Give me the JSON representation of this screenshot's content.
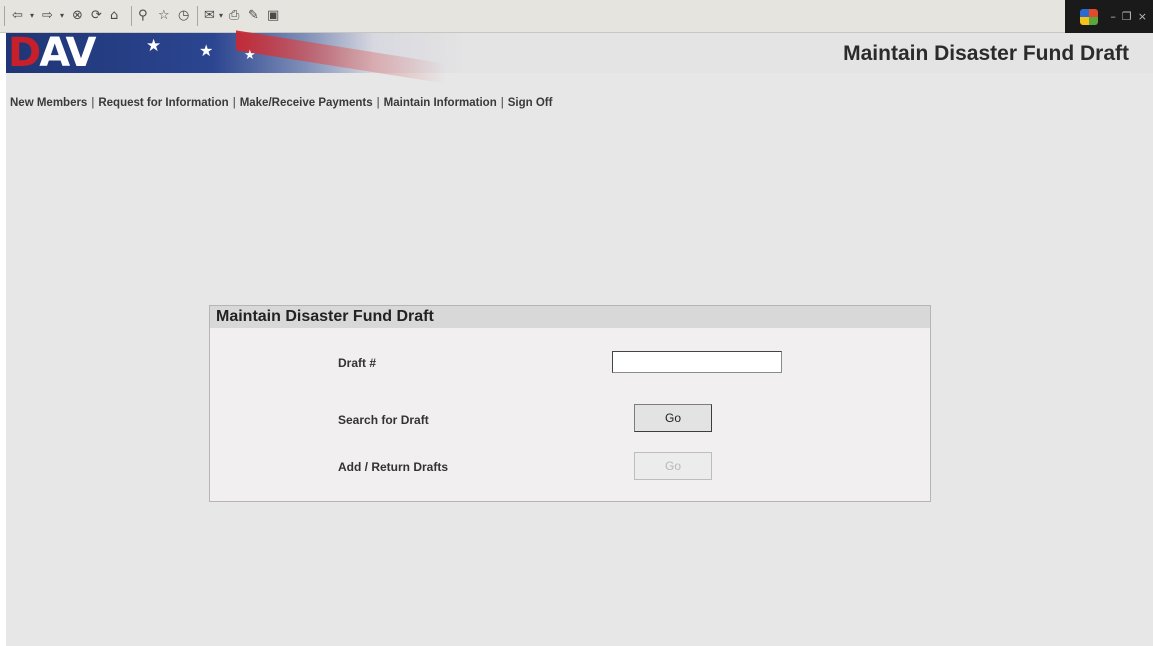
{
  "toolbar": {
    "icons": [
      "back-arrow-icon",
      "forward-arrow-icon",
      "stop-icon",
      "refresh-icon",
      "home-icon",
      "search-icon",
      "favorites-icon",
      "history-icon",
      "mail-icon",
      "print-icon",
      "edit-icon",
      "discuss-icon"
    ]
  },
  "window_controls": {
    "minimize": "–",
    "restore": "❐",
    "close": "×"
  },
  "banner": {
    "logo_part1": "D",
    "logo_part2": "AV",
    "page_title": "Maintain Disaster Fund Draft"
  },
  "nav": {
    "items": [
      {
        "label": "New Members"
      },
      {
        "label": "Request for Information"
      },
      {
        "label": "Make/Receive Payments"
      },
      {
        "label": "Maintain Information"
      },
      {
        "label": "Sign Off"
      }
    ],
    "separator": "|"
  },
  "form": {
    "title": "Maintain Disaster Fund Draft",
    "draft_label": "Draft #",
    "draft_value": "",
    "search_label": "Search for Draft",
    "search_button": "Go",
    "add_label": "Add / Return Drafts",
    "add_button": "Go",
    "add_button_enabled": false
  }
}
